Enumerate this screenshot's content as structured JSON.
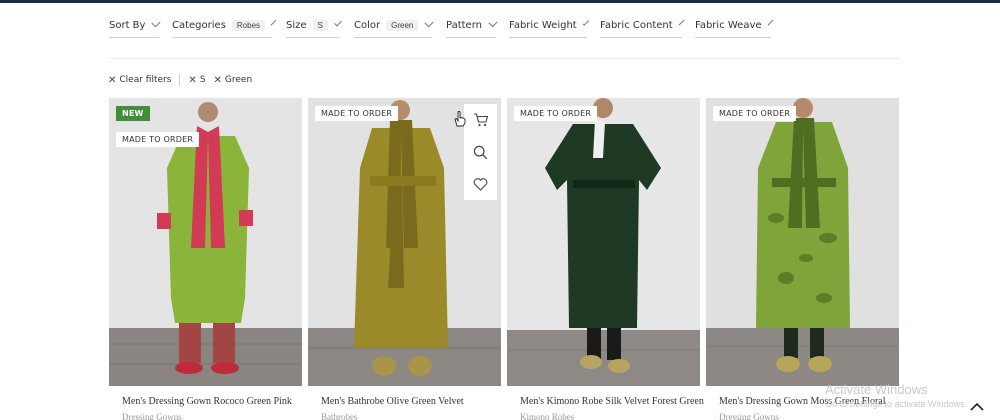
{
  "filters": [
    {
      "label": "Sort By",
      "chip": ""
    },
    {
      "label": "Categories",
      "chip": "Robes"
    },
    {
      "label": "Size",
      "chip": "S"
    },
    {
      "label": "Color",
      "chip": "Green"
    },
    {
      "label": "Pattern",
      "chip": ""
    },
    {
      "label": "Fabric Weight",
      "chip": ""
    },
    {
      "label": "Fabric Content",
      "chip": ""
    },
    {
      "label": "Fabric Weave",
      "chip": ""
    }
  ],
  "active_filters": {
    "clear": "Clear filters",
    "items": [
      "S",
      "Green"
    ]
  },
  "products": [
    {
      "title": "Men's Dressing Gown Rococo Green Pink",
      "category": "Dressing Gowns",
      "badges": [
        "NEW",
        "MADE TO ORDER"
      ],
      "robe_color": "#8ab43a",
      "accent_color": "#d23a55",
      "bg_color": "#dcdcdc"
    },
    {
      "title": "Men's Bathrobe Olive Green Velvet",
      "category": "Bathrobes",
      "badges": [
        "MADE TO ORDER"
      ],
      "robe_color": "#9a8a2a",
      "accent_color": "#7a6a1e",
      "bg_color": "#dedede"
    },
    {
      "title": "Men's Kimono Robe Silk Velvet Forest Green",
      "category": "Kimono Robes",
      "badges": [
        "MADE TO ORDER"
      ],
      "robe_color": "#1e3a24",
      "accent_color": "#132a18",
      "bg_color": "#e2e2e2"
    },
    {
      "title": "Men's Dressing Gown Moss Green Floral",
      "category": "Dressing Gowns",
      "badges": [
        "MADE TO ORDER"
      ],
      "robe_color": "#7fa43a",
      "accent_color": "#4f6e22",
      "bg_color": "#dadada"
    }
  ],
  "quick_actions": [
    "cart-icon",
    "search-icon",
    "heart-icon"
  ],
  "watermark": {
    "line1": "Activate Windows",
    "line2": "Go to Settings to activate Windows."
  }
}
